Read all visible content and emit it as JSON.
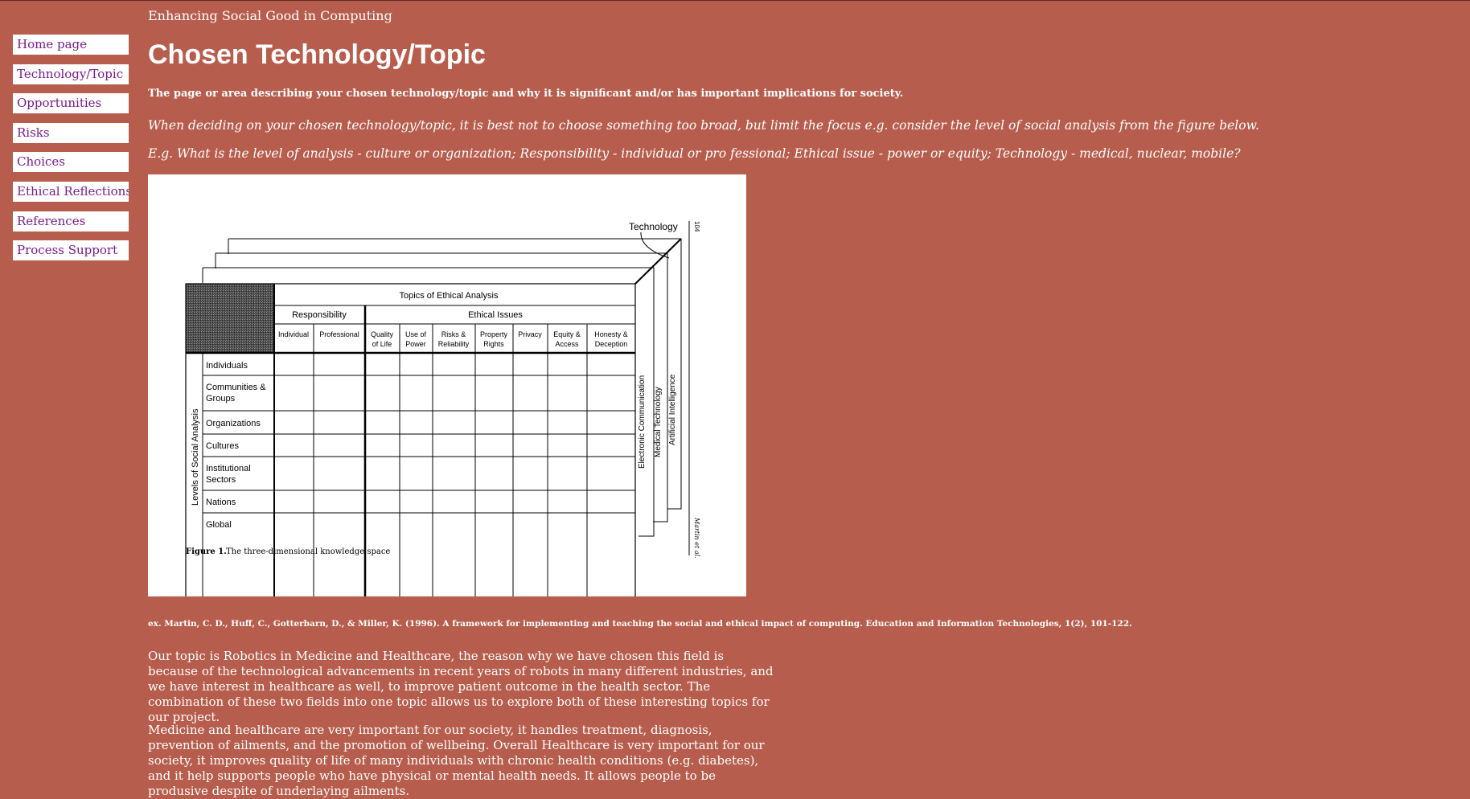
{
  "site": {
    "title": "Enhancing Social Good in Computing"
  },
  "nav": {
    "items": [
      {
        "label": "Home page"
      },
      {
        "label": "Technology/Topic"
      },
      {
        "label": "Opportunities"
      },
      {
        "label": "Risks"
      },
      {
        "label": "Choices"
      },
      {
        "label": "Ethical Reflections"
      },
      {
        "label": "References"
      },
      {
        "label": "Process Support"
      }
    ]
  },
  "page": {
    "title": "Chosen Technology/Topic",
    "lead": "The page or area describing your chosen technology/topic and why it is significant and/or has important implications for society.",
    "note_1": "When deciding on your chosen technology/topic, it is best not to choose something too broad, but limit the focus e.g. consider the level of social analysis from the figure below.",
    "note_2": "E.g. What is the level of analysis - culture or organization; Responsibility - individual or pro fessional; Ethical issue - power or equity; Technology - medical, nuclear, mobile?",
    "citation": "ex. Martin, C. D., Huff, C., Gotterbarn, D., & Miller, K. (1996). A framework for implementing and teaching the social and ethical impact of computing. Education and Information Technologies, 1(2), 101-122.",
    "paragraphs": [
      "Our topic is Robotics in Medicine and Healthcare, the reason why we have chosen this field is because of the technological advancements in recent years of robots in many different industries, and we have interest in healthcare as well, to improve patient outcome in the health sector. The combination of these two fields into one topic allows us to explore both of these interesting topics for our project.",
      "Medicine and healthcare are very important for our society, it handles treatment, diagnosis, prevention of ailments, and the promotion of wellbeing. Overall Healthcare is very important for our society, it improves quality of life of many individuals with chronic health conditions (e.g. diabetes), and it help supports people who have physical or mental health needs. It allows people to be produsive despite of underlaying ailments."
    ]
  },
  "figure": {
    "technology_label": "Technology",
    "page_number": "104",
    "running_head": "Martin et al.",
    "header_main": "Topics of Ethical Analysis",
    "group_responsibility": "Responsibility",
    "group_ethical": "Ethical Issues",
    "col_individual": "Individual",
    "col_professional": "Professional",
    "col_quality_1": "Quality",
    "col_quality_2": "of Life",
    "col_power_1": "Use of",
    "col_power_2": "Power",
    "col_risks_1": "Risks &",
    "col_risks_2": "Reliability",
    "col_property_1": "Property",
    "col_property_2": "Rights",
    "col_privacy": "Privacy",
    "col_equity_1": "Equity &",
    "col_equity_2": "Access",
    "col_honesty_1": "Honesty &",
    "col_honesty_2": "Deception",
    "row_axis_label": "Levels of Social Analysis",
    "row_individuals": "Individuals",
    "row_communities_1": "Communities &",
    "row_communities_2": "Groups",
    "row_organizations": "Organizations",
    "row_cultures": "Cultures",
    "row_institutional_1": "Institutional",
    "row_institutional_2": "Sectors",
    "row_nations": "Nations",
    "row_global": "Global",
    "tech_electronic": "Electronic Communication",
    "tech_medical": "Medical Technology",
    "tech_ai": "Artificial Intelligence",
    "caption_label": "Figure 1.",
    "caption_text": "The three-dimensional knowledge space"
  }
}
